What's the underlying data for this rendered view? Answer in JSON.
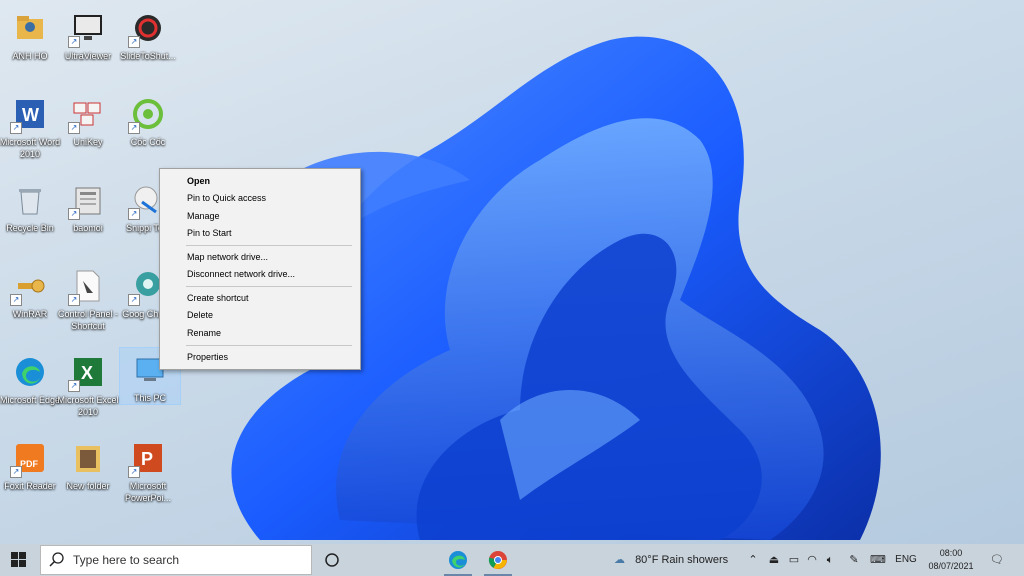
{
  "desktop": {
    "icons": [
      {
        "label": "ANH HO",
        "icon": "user-folder-icon"
      },
      {
        "label": "UltraViewer",
        "icon": "monitor-icon"
      },
      {
        "label": "SlideToShut...",
        "icon": "power-icon"
      },
      {
        "label": "Microsoft Word 2010",
        "icon": "word-icon"
      },
      {
        "label": "UniKey",
        "icon": "unikey-icon"
      },
      {
        "label": "Cốc Cốc",
        "icon": "coccoc-icon"
      },
      {
        "label": "Recycle Bin",
        "icon": "recycle-bin-icon"
      },
      {
        "label": "baomoi",
        "icon": "news-icon"
      },
      {
        "label": "Snippi Tool",
        "icon": "snipping-tool-icon"
      },
      {
        "label": "WinRAR",
        "icon": "winrar-icon"
      },
      {
        "label": "Control Panel - Shortcut",
        "icon": "control-panel-icon"
      },
      {
        "label": "Goog Chrom",
        "icon": "chrome-icon"
      },
      {
        "label": "Microsoft Edge",
        "icon": "edge-icon"
      },
      {
        "label": "Microsoft Excel 2010",
        "icon": "excel-icon"
      },
      {
        "label": "This PC",
        "icon": "this-pc-icon"
      },
      {
        "label": "Foxit Reader",
        "icon": "pdf-icon"
      },
      {
        "label": "New folder",
        "icon": "folder-icon"
      },
      {
        "label": "Microsoft PowerPoi...",
        "icon": "powerpoint-icon"
      }
    ]
  },
  "context_menu": {
    "items": [
      "Open",
      "Pin to Quick access",
      "Manage",
      "Pin to Start",
      "Map network drive...",
      "Disconnect network drive...",
      "Create shortcut",
      "Delete",
      "Rename",
      "Properties"
    ]
  },
  "taskbar": {
    "search_placeholder": "Type here to search",
    "weather": "80°F  Rain showers",
    "language": "ENG",
    "time": "08:00",
    "date": "08/07/2021"
  },
  "colors": {
    "taskbar": "#c9d3dc",
    "menu_bg": "#f2f2f2",
    "wallpaper_blue": "#1a5cff"
  }
}
